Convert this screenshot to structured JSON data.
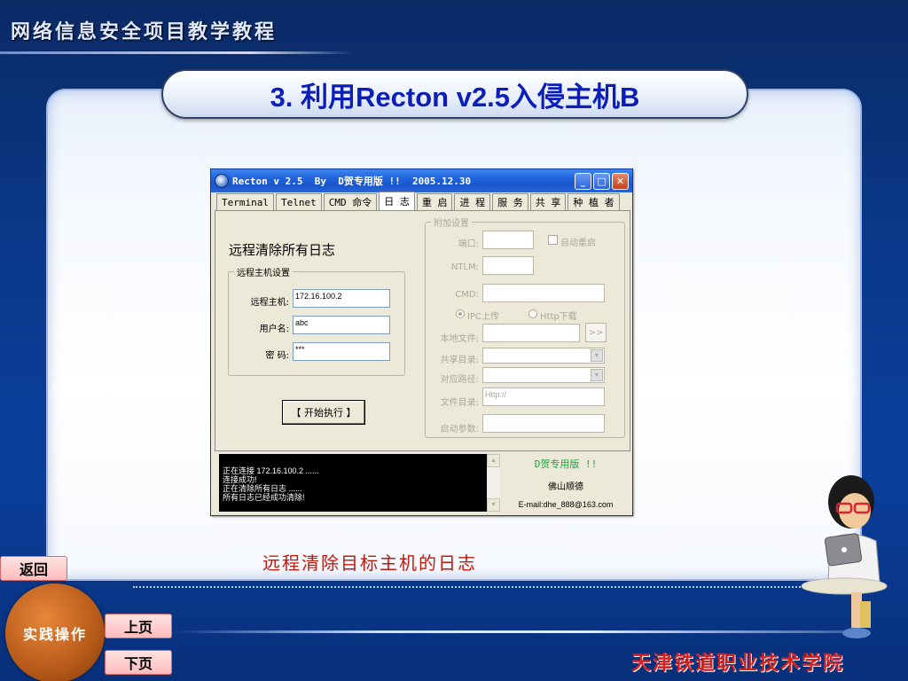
{
  "header": {
    "course_title": "网络信息安全项目教学教程"
  },
  "slide": {
    "title": "3. 利用Recton v2.5入侵主机B",
    "caption": "远程清除目标主机的日志"
  },
  "app": {
    "title": "Recton v 2.5  By  D贺专用版 !!  2005.12.30",
    "controls": {
      "minimize": "_",
      "maximize": "□",
      "close": "✕"
    },
    "tabs": [
      {
        "label": "Terminal"
      },
      {
        "label": "Telnet"
      },
      {
        "label": "CMD 命令"
      },
      {
        "label": "日 志"
      },
      {
        "label": "重 启"
      },
      {
        "label": "进 程"
      },
      {
        "label": "服 务"
      },
      {
        "label": "共 享"
      },
      {
        "label": "种 植 者"
      }
    ],
    "active_tab": "日 志",
    "heading": "远程清除所有日志",
    "remote_group": {
      "legend": "远程主机设置",
      "host_label": "远程主机:",
      "host_value": "172.16.100.2",
      "user_label": "用户名:",
      "user_value": "abc",
      "pass_label": "密 码:",
      "pass_value": "***"
    },
    "start_button": "【 开始执行 】",
    "extra_group": {
      "legend": "附加设置",
      "port_label": "端口:",
      "autorestart_label": "自动重启",
      "ntlm_label": "NTLM:",
      "cmd_label": "CMD:",
      "ipc_label": "IPC上传",
      "http_label": "Http下载",
      "localfile_label": "本地文件:",
      "browse_label": ">>",
      "share_label": "共享目录:",
      "path_label": "对应路径:",
      "filedir_label": "文件目录:",
      "filedir_value": "Http://",
      "args_label": "启动参数:"
    },
    "log": [
      "正在连接 172.16.100.2 ......",
      "连接成功!",
      "正在清除所有日志 ......",
      "所有日志已经成功清除!"
    ],
    "info": {
      "brand": "D贺专用版 !!",
      "place": "佛山顺德",
      "email": "E-mail:dhe_888@163.com"
    }
  },
  "nav": {
    "back": "返回",
    "practice": "实践操作",
    "prev": "上页",
    "next": "下页"
  },
  "footer": {
    "school": "天津铁道职业技术学院"
  }
}
